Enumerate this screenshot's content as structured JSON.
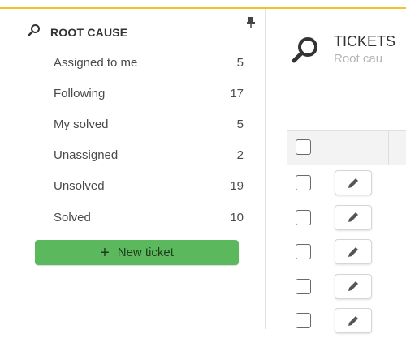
{
  "sidebar": {
    "section_title": "ROOT CAUSE",
    "section_icon": "search-wrench-icon",
    "pin_icon": "pin-icon",
    "items": [
      {
        "label": "Assigned to me",
        "count": "5"
      },
      {
        "label": "Following",
        "count": "17"
      },
      {
        "label": "My solved",
        "count": "5"
      },
      {
        "label": "Unassigned",
        "count": "2"
      },
      {
        "label": "Unsolved",
        "count": "19"
      },
      {
        "label": "Solved",
        "count": "10"
      }
    ],
    "new_ticket": {
      "icon": "plus-icon",
      "label": "New ticket"
    }
  },
  "main": {
    "title": "TICKETS",
    "subtitle": "Root cau",
    "title_icon": "search-wrench-icon"
  },
  "table": {
    "rows": 5,
    "row_action_icon": "pencil-icon"
  },
  "colors": {
    "accent_line": "#f0c230",
    "new_ticket_button": "#5cb85c",
    "header_bg": "#f3f3f3"
  }
}
